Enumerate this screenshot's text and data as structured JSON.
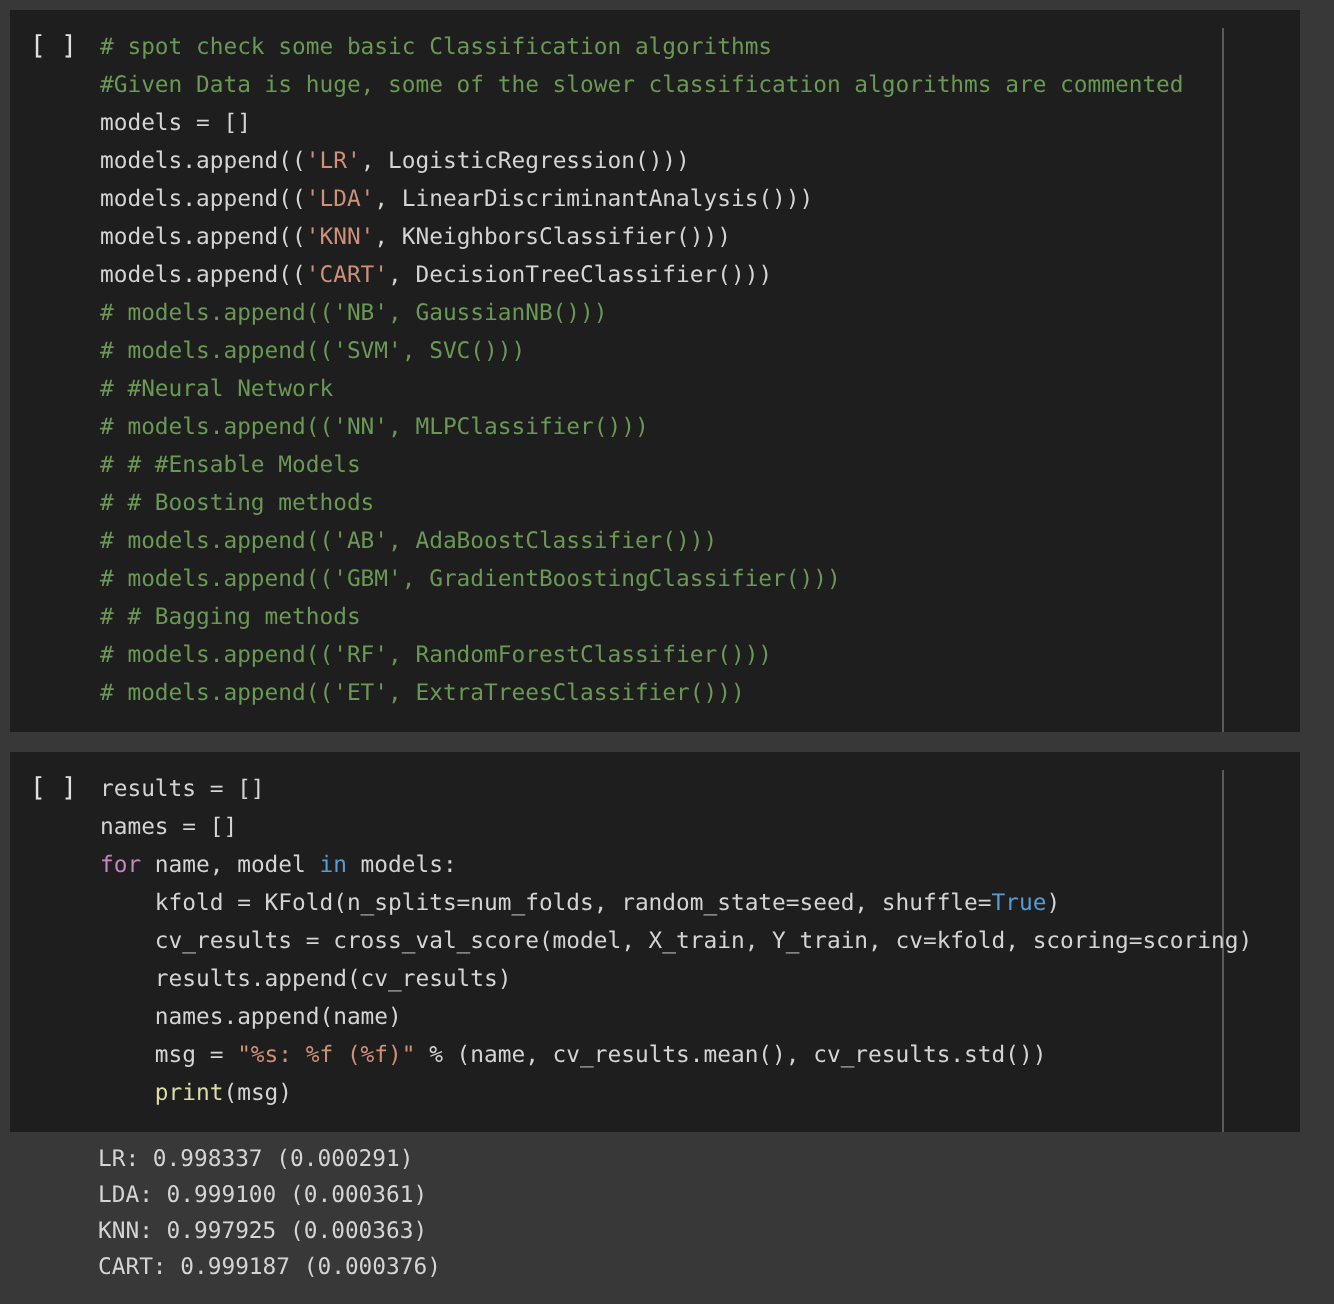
{
  "cells": [
    {
      "run_marker": "[ ]",
      "lines": [
        [
          {
            "kind": "comment",
            "text": "# spot check some basic Classification algorithms"
          }
        ],
        [
          {
            "kind": "comment",
            "text": "#Given Data is huge, some of the slower classification algorithms are commented"
          }
        ],
        [
          {
            "kind": "plain",
            "text": "models = []"
          }
        ],
        [
          {
            "kind": "plain",
            "text": "models.append(("
          },
          {
            "kind": "string",
            "text": "'LR'"
          },
          {
            "kind": "plain",
            "text": ", LogisticRegression()))"
          }
        ],
        [
          {
            "kind": "plain",
            "text": "models.append(("
          },
          {
            "kind": "string",
            "text": "'LDA'"
          },
          {
            "kind": "plain",
            "text": ", LinearDiscriminantAnalysis()))"
          }
        ],
        [
          {
            "kind": "plain",
            "text": "models.append(("
          },
          {
            "kind": "string",
            "text": "'KNN'"
          },
          {
            "kind": "plain",
            "text": ", KNeighborsClassifier()))"
          }
        ],
        [
          {
            "kind": "plain",
            "text": "models.append(("
          },
          {
            "kind": "string",
            "text": "'CART'"
          },
          {
            "kind": "plain",
            "text": ", DecisionTreeClassifier()))"
          }
        ],
        [
          {
            "kind": "comment",
            "text": "# models.append(('NB', GaussianNB()))"
          }
        ],
        [
          {
            "kind": "comment",
            "text": "# models.append(('SVM', SVC()))"
          }
        ],
        [
          {
            "kind": "comment",
            "text": "# #Neural Network"
          }
        ],
        [
          {
            "kind": "comment",
            "text": "# models.append(('NN', MLPClassifier()))"
          }
        ],
        [
          {
            "kind": "comment",
            "text": "# # #Ensable Models"
          }
        ],
        [
          {
            "kind": "comment",
            "text": "# # Boosting methods"
          }
        ],
        [
          {
            "kind": "comment",
            "text": "# models.append(('AB', AdaBoostClassifier()))"
          }
        ],
        [
          {
            "kind": "comment",
            "text": "# models.append(('GBM', GradientBoostingClassifier()))"
          }
        ],
        [
          {
            "kind": "comment",
            "text": "# # Bagging methods"
          }
        ],
        [
          {
            "kind": "comment",
            "text": "# models.append(('RF', RandomForestClassifier()))"
          }
        ],
        [
          {
            "kind": "comment",
            "text": "# models.append(('ET', ExtraTreesClassifier()))"
          }
        ]
      ]
    },
    {
      "run_marker": "[ ]",
      "lines": [
        [
          {
            "kind": "plain",
            "text": "results = []"
          }
        ],
        [
          {
            "kind": "plain",
            "text": "names = []"
          }
        ],
        [
          {
            "kind": "control",
            "text": "for"
          },
          {
            "kind": "plain",
            "text": " name, model "
          },
          {
            "kind": "keyword",
            "text": "in"
          },
          {
            "kind": "plain",
            "text": " models:"
          }
        ],
        [
          {
            "kind": "plain",
            "text": "    kfold = KFold(n_splits=num_folds, random_state=seed, shuffle="
          },
          {
            "kind": "keyword",
            "text": "True"
          },
          {
            "kind": "plain",
            "text": ")"
          }
        ],
        [
          {
            "kind": "plain",
            "text": "    cv_results = cross_val_score(model, X_train, Y_train, cv=kfold, scoring=scoring)"
          }
        ],
        [
          {
            "kind": "plain",
            "text": "    results.append(cv_results)"
          }
        ],
        [
          {
            "kind": "plain",
            "text": "    names.append(name)"
          }
        ],
        [
          {
            "kind": "plain",
            "text": "    msg = "
          },
          {
            "kind": "string",
            "text": "\"%s: %f (%f)\""
          },
          {
            "kind": "plain",
            "text": " % (name, cv_results.mean(), cv_results.std())"
          }
        ],
        [
          {
            "kind": "function",
            "text": "    print"
          },
          {
            "kind": "plain",
            "text": "(msg)"
          }
        ]
      ],
      "output": [
        "LR: 0.998337 (0.000291)",
        "LDA: 0.999100 (0.000361)",
        "KNN: 0.997925 (0.000363)",
        "CART: 0.999187 (0.000376)"
      ]
    }
  ]
}
